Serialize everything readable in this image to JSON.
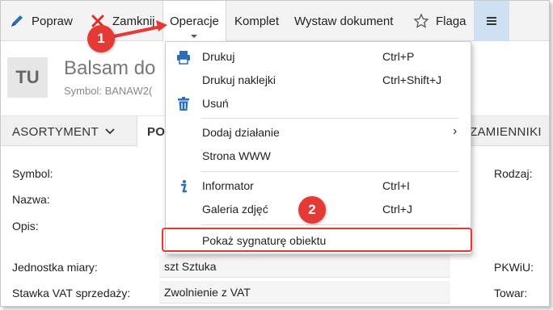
{
  "toolbar": {
    "edit_label": "Popraw",
    "close_label": "Zamknij",
    "operations_label": "Operacje",
    "set_label": "Komplet",
    "issue_doc_label": "Wystaw dokument",
    "flag_label": "Flaga",
    "colors": {
      "edit_icon": "#2a6ebb",
      "close_icon": "#d9302c",
      "menu_bg": "#cfe0f2"
    }
  },
  "header": {
    "badge": "TU",
    "title": "Balsam do",
    "subtitle": "Symbol: BANAW2("
  },
  "tabs": [
    {
      "label": "ASORTYMENT"
    },
    {
      "label": "PO"
    },
    {
      "label": "ZAMIENNIKI"
    }
  ],
  "form": {
    "symbol_label": "Symbol:",
    "name_label": "Nazwa:",
    "desc_label": "Opis:",
    "unit_label": "Jednostka miary:",
    "unit_value": "szt  Sztuka",
    "vat_label": "Stawka VAT sprzedaży:",
    "vat_value": "Zwolnienie z VAT",
    "kind_label": "Rodzaj:",
    "pkwiu_label": "PKWiU:",
    "goods_label": "Towar:"
  },
  "menu": {
    "items": [
      {
        "label": "Drukuj",
        "shortcut": "Ctrl+P",
        "icon": "printer-icon"
      },
      {
        "label": "Drukuj naklejki",
        "shortcut": "Ctrl+Shift+J",
        "icon": ""
      },
      {
        "label": "Usuń",
        "shortcut": "",
        "icon": "trash-icon"
      },
      {
        "label": "Dodaj działanie",
        "shortcut": "",
        "icon": "",
        "submenu": "›"
      },
      {
        "label": "Strona WWW",
        "shortcut": "",
        "icon": ""
      },
      {
        "label": "Informator",
        "shortcut": "Ctrl+I",
        "icon": "info-icon"
      },
      {
        "label": "Galeria zdjęć",
        "shortcut": "Ctrl+J",
        "icon": ""
      },
      {
        "label": "Pokaż sygnaturę obiektu",
        "shortcut": "",
        "icon": ""
      }
    ]
  },
  "annotations": {
    "step1": "1",
    "step2": "2",
    "color": "#e53935"
  }
}
